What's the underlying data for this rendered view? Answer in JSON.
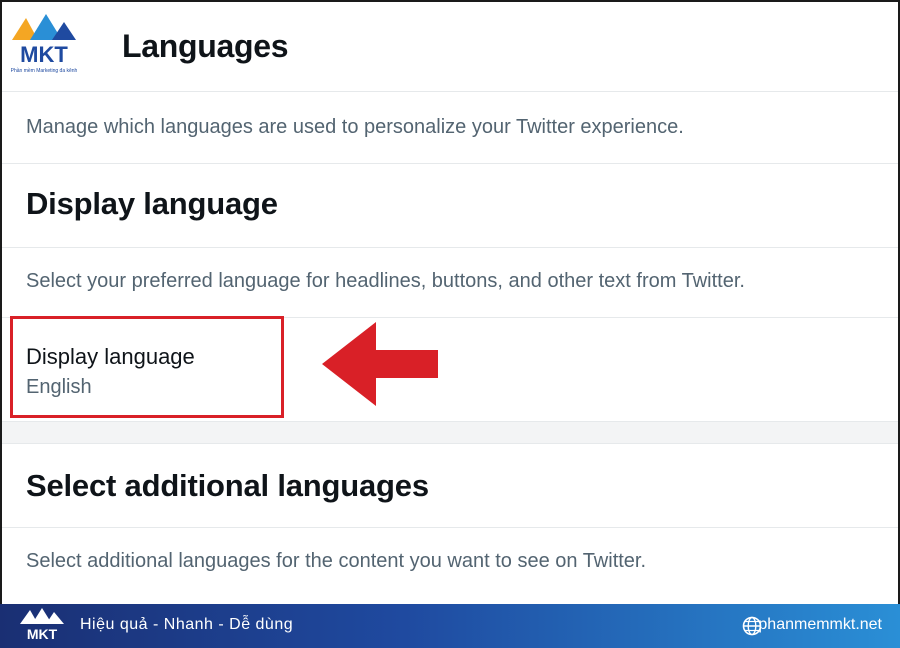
{
  "header": {
    "title": "Languages"
  },
  "brand": {
    "logo_text": "MKT",
    "logo_tagline": "Phần mềm Marketing đa kênh"
  },
  "intro": {
    "description": "Manage which languages are used to personalize your Twitter experience."
  },
  "display_language_section": {
    "title": "Display language",
    "description": "Select your preferred language for headlines, buttons, and other text from Twitter.",
    "setting_label": "Display language",
    "setting_value": "English"
  },
  "additional_languages_section": {
    "title": "Select additional languages",
    "description": "Select additional languages for the content you want to see on Twitter."
  },
  "annotation": {
    "highlight_color": "#d92027",
    "arrow_icon": "arrow-left-icon"
  },
  "footer": {
    "slogan": "Hiệu quả - Nhanh  - Dễ dùng",
    "site": "phanmemmkt.net",
    "globe_icon": "globe-icon"
  },
  "colors": {
    "text_primary": "#0f1419",
    "text_secondary": "#536471",
    "divider": "#e6e9eb",
    "annotation_red": "#d92027",
    "footer_start": "#1a2f73",
    "footer_end": "#2a8fd6"
  }
}
